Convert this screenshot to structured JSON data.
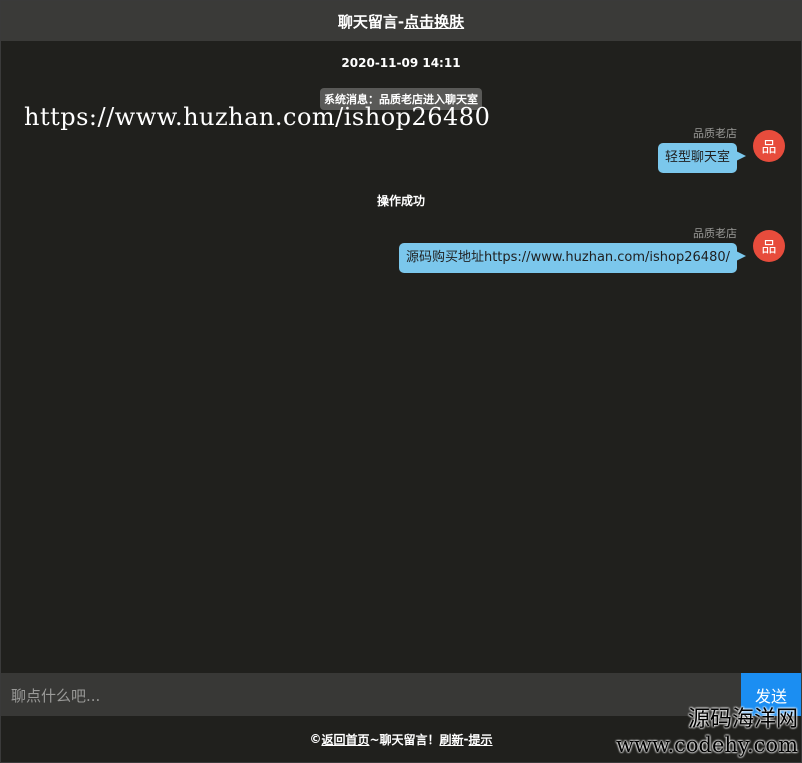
{
  "header": {
    "title_prefix": "聊天留言-",
    "skin_link": "点击换肤"
  },
  "chat": {
    "timestamp": "2020-11-09 14:11",
    "system_message": "系统消息：品质老店进入聊天室",
    "watermark": "https://www.huzhan.com/ishop26480",
    "operation_message": "操作成功",
    "messages": [
      {
        "name": "品质老店",
        "avatar": "品",
        "text": "轻型聊天室"
      },
      {
        "name": "品质老店",
        "avatar": "品",
        "text": "源码购买地址https://www.huzhan.com/ishop26480/"
      }
    ]
  },
  "input": {
    "placeholder": "聊点什么吧...",
    "send_label": "发送"
  },
  "footer": {
    "copyright": "©",
    "home_link": "返回首页",
    "middle": "~聊天留言！",
    "refresh_link": "刷新",
    "dash": "-",
    "tips_link": "提示"
  },
  "corner_watermark": {
    "line1": "源码海洋网",
    "line2": "www.codehy.com"
  },
  "colors": {
    "background": "#20201d",
    "bubble": "#7bc7ec",
    "avatar": "#e74c3c",
    "send": "#1b8ef2"
  }
}
